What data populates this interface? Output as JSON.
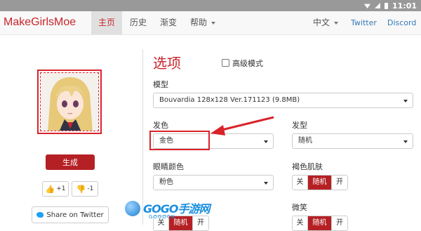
{
  "status": {
    "time": "11:01"
  },
  "navbar": {
    "brand": "MakeGirlsMoe",
    "items": [
      {
        "label": "主页"
      },
      {
        "label": "历史"
      },
      {
        "label": "渐变"
      },
      {
        "label": "帮助"
      }
    ],
    "language": "中文",
    "twitter": "Twitter",
    "discord": "Discord"
  },
  "left": {
    "generate_label": "生成",
    "upvote": "+1",
    "downvote": "-1",
    "share_label": "Share on Twitter"
  },
  "options": {
    "title": "选项",
    "advanced_label": "高级模式",
    "model_label": "模型",
    "model_value": "Bouvardia 128x128 Ver.171123 (9.8MB)",
    "hair_color_label": "发色",
    "hair_color_value": "金色",
    "hair_style_label": "发型",
    "hair_style_value": "随机",
    "eye_color_label": "眼睛颜色",
    "eye_color_value": "粉色",
    "dark_skin_label": "褐色肌肤",
    "smile_label": "微笑",
    "seg_off": "关",
    "seg_random": "随机",
    "seg_on": "开"
  },
  "watermark": {
    "text": "GOGO手游网",
    "sub": "GOGOCN"
  },
  "colors": {
    "brand": "#c9252b",
    "accent": "#b52024",
    "link": "#337ab7"
  }
}
